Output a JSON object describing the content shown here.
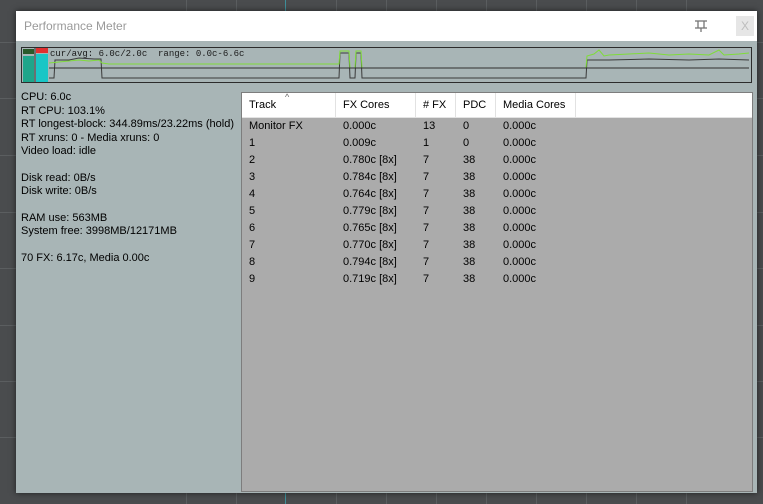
{
  "window": {
    "title": "Performance Meter",
    "close_label": "X"
  },
  "graph": {
    "label": "cur/avg: 6.0c/2.0c  range: 0.0c-6.6c",
    "colors": {
      "meter_green": "#1fa58a",
      "meter_cyan": "#19c6c6",
      "meter_red": "#e03030",
      "line_green": "#7fdc3a",
      "line_dark": "#3a3a3a"
    }
  },
  "stats": {
    "cpu": "CPU: 6.0c",
    "rt_cpu": "RT CPU: 103.1%",
    "rt_longest_block": "RT longest-block: 344.89ms/23.22ms (hold)",
    "xruns": "RT xruns: 0 - Media xruns: 0",
    "video_load": "Video load: idle",
    "disk_read": "Disk read: 0B/s",
    "disk_write": "Disk write: 0B/s",
    "ram_use": "RAM use: 563MB",
    "system_free": "System free: 3998MB/12171MB",
    "fx_summary": "70 FX: 6.17c, Media 0.00c"
  },
  "table": {
    "columns": [
      "Track",
      "FX Cores",
      "# FX",
      "PDC",
      "Media Cores"
    ],
    "rows": [
      [
        "Monitor FX",
        "0.000c",
        "13",
        "0",
        "0.000c"
      ],
      [
        "1",
        "0.009c",
        "1",
        "0",
        "0.000c"
      ],
      [
        "2",
        "0.780c [8x]",
        "7",
        "38",
        "0.000c"
      ],
      [
        "3",
        "0.784c [8x]",
        "7",
        "38",
        "0.000c"
      ],
      [
        "4",
        "0.764c [8x]",
        "7",
        "38",
        "0.000c"
      ],
      [
        "5",
        "0.779c [8x]",
        "7",
        "38",
        "0.000c"
      ],
      [
        "6",
        "0.765c [8x]",
        "7",
        "38",
        "0.000c"
      ],
      [
        "7",
        "0.770c [8x]",
        "7",
        "38",
        "0.000c"
      ],
      [
        "8",
        "0.794c [8x]",
        "7",
        "38",
        "0.000c"
      ],
      [
        "9",
        "0.719c [8x]",
        "7",
        "38",
        "0.000c"
      ]
    ]
  }
}
